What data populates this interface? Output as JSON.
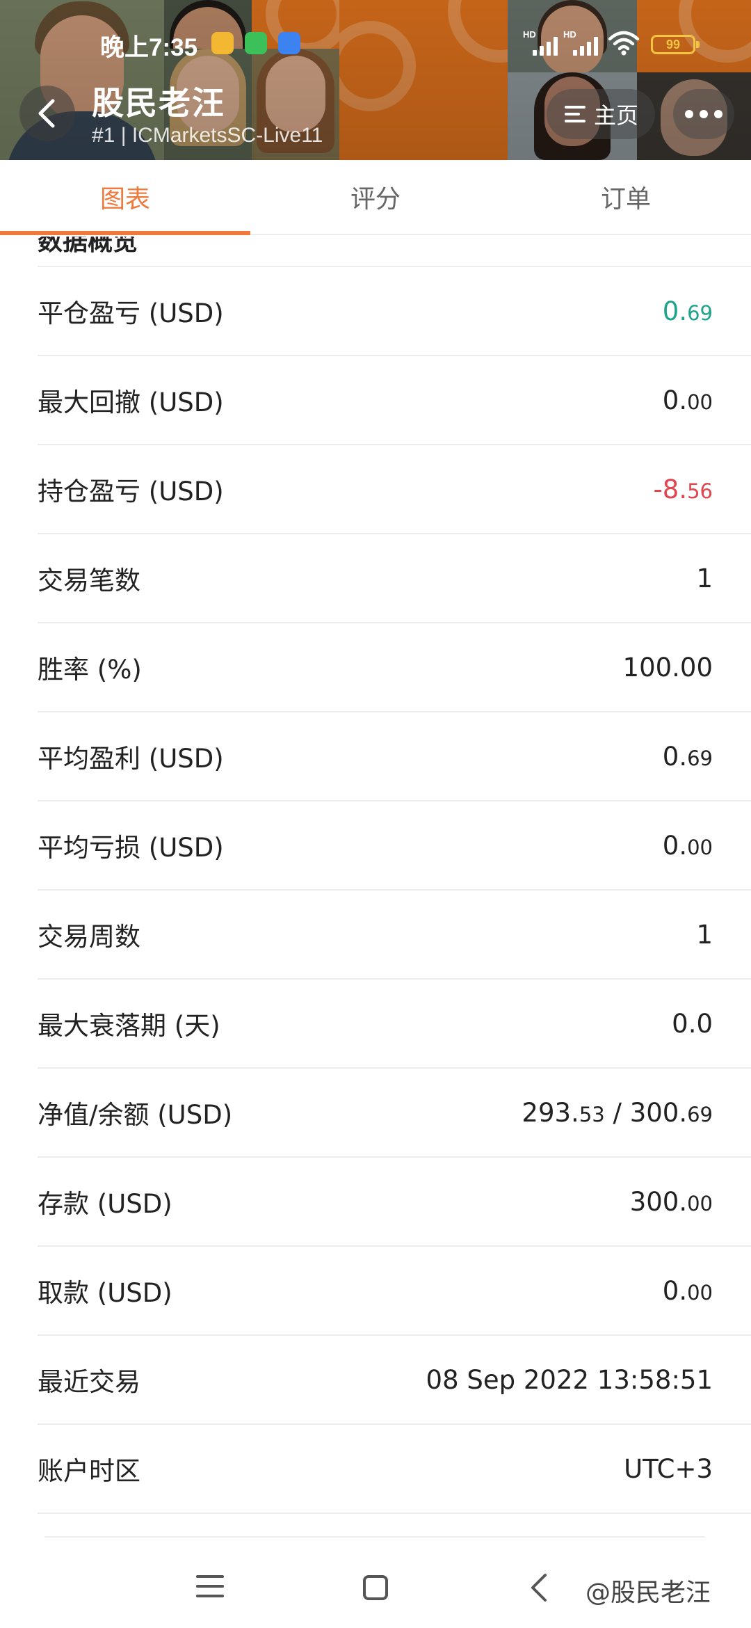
{
  "status_bar": {
    "time": "晚上7:35",
    "signal_1": "HD",
    "signal_2": "HD",
    "battery": "99"
  },
  "header": {
    "title": "股民老汪",
    "subtitle": "#1 | ICMarketsSC-Live11",
    "home_label": "主页"
  },
  "tabs": [
    {
      "label": "图表",
      "active": true
    },
    {
      "label": "评分",
      "active": false
    },
    {
      "label": "订单",
      "active": false
    }
  ],
  "cut_heading": "数据概览",
  "stats": [
    {
      "label": "平仓盈亏 (USD)",
      "int": "0.",
      "dec": "69",
      "tone": "green"
    },
    {
      "label": "最大回撤 (USD)",
      "int": "0.",
      "dec": "00",
      "tone": ""
    },
    {
      "label": "持仓盈亏 (USD)",
      "int": "-8.",
      "dec": "56",
      "tone": "red"
    },
    {
      "label": "交易笔数",
      "int": "1",
      "dec": "",
      "tone": ""
    },
    {
      "label": "胜率 (%)",
      "int": "100.00",
      "dec": "",
      "tone": ""
    },
    {
      "label": "平均盈利 (USD)",
      "int": "0.",
      "dec": "69",
      "tone": ""
    },
    {
      "label": "平均亏损 (USD)",
      "int": "0.",
      "dec": "00",
      "tone": ""
    },
    {
      "label": "交易周数",
      "int": "1",
      "dec": "",
      "tone": ""
    },
    {
      "label": "最大衰落期 (天)",
      "int": "0.0",
      "dec": "",
      "tone": ""
    },
    {
      "label": "净值/余额 (USD)",
      "int": "293.",
      "dec": "53",
      "int2": " / 300.",
      "dec2": "69",
      "tone": ""
    },
    {
      "label": "存款 (USD)",
      "int": "300.",
      "dec": "00",
      "tone": ""
    },
    {
      "label": "取款 (USD)",
      "int": "0.",
      "dec": "00",
      "tone": ""
    },
    {
      "label": "最近交易",
      "int": "08 Sep 2022 13:58:51",
      "dec": "",
      "tone": ""
    },
    {
      "label": "账户时区",
      "int": "UTC+3",
      "dec": "",
      "tone": ""
    }
  ],
  "watermark": "@股民老汪",
  "colors": {
    "accent": "#f07a3c",
    "positive": "#1ea48c",
    "negative": "#e14550",
    "header_orange": "#f07a1f"
  }
}
